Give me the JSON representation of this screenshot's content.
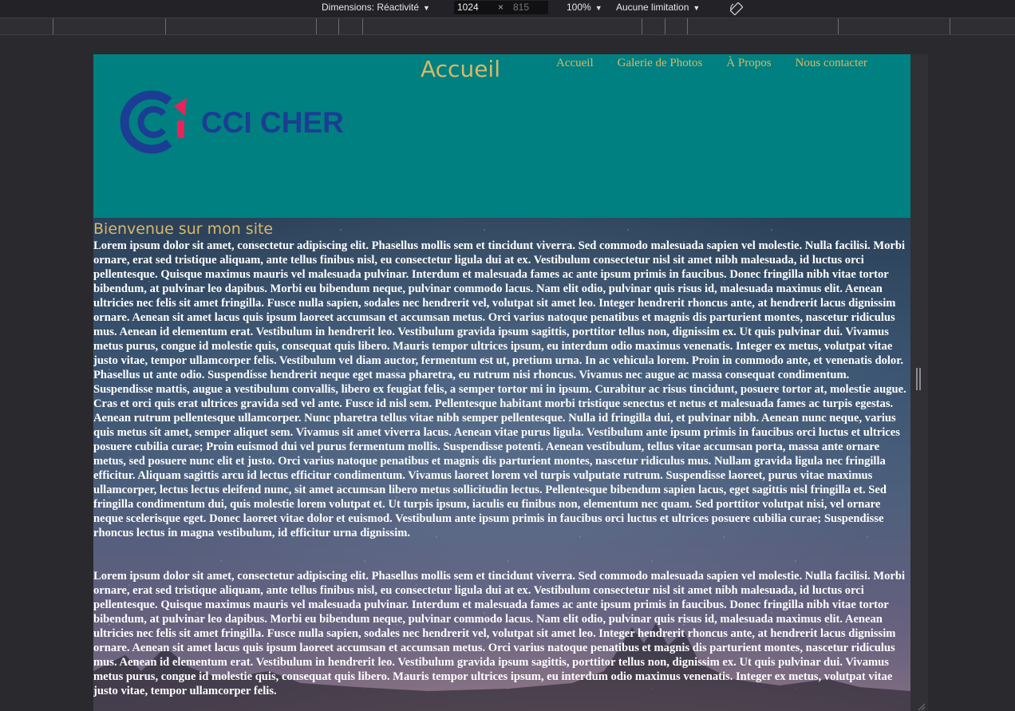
{
  "toolbar": {
    "dimensions_label": "Dimensions: Réactivité",
    "width_value": "1024",
    "times_symbol": "×",
    "height_value": "815",
    "zoom_label": "100%",
    "throttling_label": "Aucune limitation",
    "rotate_icon": "rotate-icon"
  },
  "header": {
    "logo_text": "CCI CHER",
    "page_title": "Accueil",
    "nav": [
      "Accueil",
      "Galerie de Photos",
      "À Propos",
      "Nous contacter"
    ]
  },
  "main": {
    "welcome": "Bienvenue sur mon site",
    "paragraphs": [
      "Lorem ipsum dolor sit amet, consectetur adipiscing elit. Phasellus mollis sem et tincidunt viverra. Sed commodo malesuada sapien vel molestie. Nulla facilisi. Morbi ornare, erat sed tristique aliquam, ante tellus finibus nisl, eu consectetur ligula dui at ex. Vestibulum consectetur nisl sit amet nibh malesuada, id luctus orci pellentesque. Quisque maximus mauris vel malesuada pulvinar. Interdum et malesuada fames ac ante ipsum primis in faucibus. Donec fringilla nibh vitae tortor bibendum, at pulvinar leo dapibus. Morbi eu bibendum neque, pulvinar commodo lacus. Nam elit odio, pulvinar quis risus id, malesuada maximus elit. Aenean ultricies nec felis sit amet fringilla. Fusce nulla sapien, sodales nec hendrerit vel, volutpat sit amet leo. Integer hendrerit rhoncus ante, at hendrerit lacus dignissim ornare. Aenean sit amet lacus quis ipsum laoreet accumsan et accumsan metus. Orci varius natoque penatibus et magnis dis parturient montes, nascetur ridiculus mus. Aenean id elementum erat. Vestibulum in hendrerit leo. Vestibulum gravida ipsum sagittis, porttitor tellus non, dignissim ex. Ut quis pulvinar dui. Vivamus metus purus, congue id molestie quis, consequat quis libero. Mauris tempor ultrices ipsum, eu interdum odio maximus venenatis. Integer ex metus, volutpat vitae justo vitae, tempor ullamcorper felis. Vestibulum vel diam auctor, fermentum est ut, pretium urna. In ac vehicula lorem. Proin in commodo ante, et venenatis dolor. Phasellus ut ante odio. Suspendisse hendrerit neque eget massa pharetra, eu rutrum nisi rhoncus. Vivamus nec augue ac massa consequat condimentum. Suspendisse mattis, augue a vestibulum convallis, libero ex feugiat felis, a semper tortor mi in ipsum. Curabitur ac risus tincidunt, posuere tortor at, molestie augue. Cras et orci quis erat ultrices gravida sed vel ante. Fusce id nisl sem. Pellentesque habitant morbi tristique senectus et netus et malesuada fames ac turpis egestas. Aenean rutrum pellentesque ullamcorper. Nunc pharetra tellus vitae nibh semper pellentesque. Nulla id fringilla dui, et pulvinar nibh. Aenean nunc neque, varius quis metus sit amet, semper aliquet sem. Vivamus sit amet viverra lacus. Aenean vitae purus ligula. Vestibulum ante ipsum primis in faucibus orci luctus et ultrices posuere cubilia curae; Proin euismod dui vel purus fermentum mollis. Suspendisse potenti. Aenean vestibulum, tellus vitae accumsan porta, massa ante ornare metus, sed posuere nunc elit et justo. Orci varius natoque penatibus et magnis dis parturient montes, nascetur ridiculus mus. Nullam gravida ligula nec fringilla efficitur. Aliquam sagittis arcu id lectus efficitur condimentum. Vivamus laoreet lorem vel turpis vulputate rutrum. Suspendisse laoreet, purus vitae maximus ullamcorper, lectus lectus eleifend nunc, sit amet accumsan libero metus sollicitudin lectus. Pellentesque bibendum sapien lacus, eget sagittis nisl fringilla et. Sed fringilla condimentum dui, quis molestie lorem volutpat et. Ut turpis ipsum, iaculis eu finibus non, elementum nec quam. Sed porttitor volutpat nisi, vel ornare neque scelerisque eget. Donec laoreet vitae dolor et euismod. Vestibulum ante ipsum primis in faucibus orci luctus et ultrices posuere cubilia curae; Suspendisse rhoncus lectus in magna vestibulum, id efficitur urna dignissim.",
      "Lorem ipsum dolor sit amet, consectetur adipiscing elit. Phasellus mollis sem et tincidunt viverra. Sed commodo malesuada sapien vel molestie. Nulla facilisi. Morbi ornare, erat sed tristique aliquam, ante tellus finibus nisl, eu consectetur ligula dui at ex. Vestibulum consectetur nisl sit amet nibh malesuada, id luctus orci pellentesque. Quisque maximus mauris vel malesuada pulvinar. Interdum et malesuada fames ac ante ipsum primis in faucibus. Donec fringilla nibh vitae tortor bibendum, at pulvinar leo dapibus. Morbi eu bibendum neque, pulvinar commodo lacus. Nam elit odio, pulvinar quis risus id, malesuada maximus elit. Aenean ultricies nec felis sit amet fringilla. Fusce nulla sapien, sodales nec hendrerit vel, volutpat sit amet leo. Integer hendrerit rhoncus ante, at hendrerit lacus dignissim ornare. Aenean sit amet lacus quis ipsum laoreet accumsan et accumsan metus. Orci varius natoque penatibus et magnis dis parturient montes, nascetur ridiculus mus. Aenean id elementum erat. Vestibulum in hendrerit leo. Vestibulum gravida ipsum sagittis, porttitor tellus non, dignissim ex. Ut quis pulvinar dui. Vivamus metus purus, congue id molestie quis, consequat quis libero. Mauris tempor ultrices ipsum, eu interdum odio maximus venenatis. Integer ex metus, volutpat vitae justo vitae, tempor ullamcorper felis."
    ]
  },
  "colors": {
    "header_bg": "#008080",
    "accent_gold": "#d8b86a",
    "logo_blue": "#1c3d94",
    "logo_pink": "#e8245a"
  }
}
